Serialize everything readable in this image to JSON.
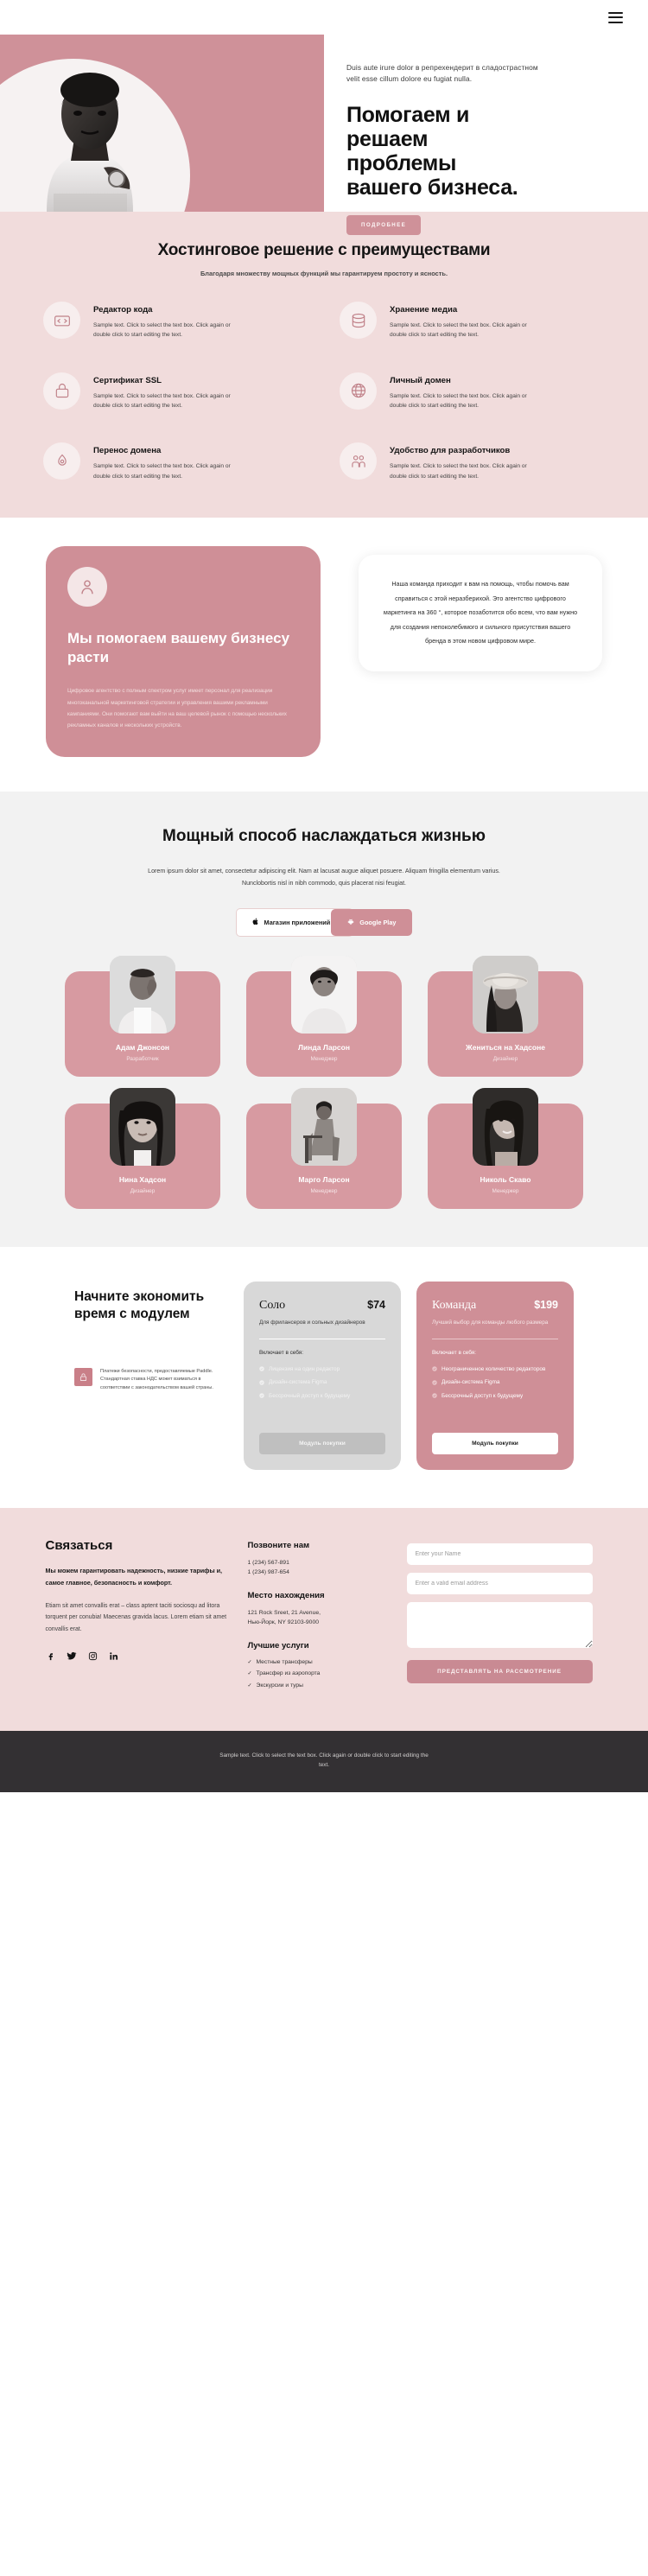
{
  "nav": {
    "menu_icon": "hamburger-menu-icon"
  },
  "hero": {
    "lead": "Duis aute irure dolor в репрехендерит в сладострастном velit esse cillum dolore eu fugiat nulla.",
    "title": "Помогаем и решаем проблемы вашего бизнеса.",
    "cta": "ПОДРОБНЕЕ"
  },
  "features": {
    "title": "Хостинговое решение с преимуществами",
    "subtitle": "Благодаря множеству мощных функций мы гарантируем простоту и ясность.",
    "body": "Sample text. Click to select the text box. Click again or double click to start editing the text.",
    "items": [
      {
        "icon": "code-editor-icon",
        "title": "Редактор кода"
      },
      {
        "icon": "database-storage-icon",
        "title": "Хранение медиа"
      },
      {
        "icon": "ssl-lock-icon",
        "title": "Сертификат SSL"
      },
      {
        "icon": "globe-www-icon",
        "title": "Личный домен"
      },
      {
        "icon": "domain-transfer-icon",
        "title": "Перенос домена"
      },
      {
        "icon": "developers-group-icon",
        "title": "Удобство для разработчиков"
      }
    ]
  },
  "help": {
    "avatar_icon": "person-avatar-icon",
    "title": "Мы помогаем вашему бизнесу расти",
    "body": "Цифровое агентство с полным спектром услуг имеет персонал для реализации многоканальной маркетинговой стратегии и управления вашими рекламными кампаниями. Они помогают вам выйти на ваш целевой рынок с помощью нескольких рекламных каналов и нескольких устройств.",
    "quote": "Наша команда приходит к вам на помощь, чтобы помочь вам справиться с этой неразберихой. Это агентство цифрового маркетинга на 360 °, которое позаботится обо всем, что вам нужно для создания непоколебимого и сильного присутствия вашего бренда в этом новом цифровом мире."
  },
  "power": {
    "title": "Мощный способ наслаждаться жизнью",
    "body": "Lorem ipsum dolor sit amet, consectetur adipiscing elit. Nam at lacusat augue aliquet posuere. Aliquam fringilla elementum varius. Nunclobortis nisl in nibh commodo, quis placerat nisi feugiat.",
    "appstore_label": "Магазин приложений",
    "appstore_icon": "apple-icon",
    "googleplay_label": "Google Play",
    "googleplay_icon": "android-icon"
  },
  "team": {
    "members": [
      {
        "name": "Адам Джонсон",
        "role": "Разработчик",
        "photo": "portrait-man-hand-on-face"
      },
      {
        "name": "Линда Ларсон",
        "role": "Менеджер",
        "photo": "portrait-woman-smiling"
      },
      {
        "name": "Жениться на Хадсоне",
        "role": "Дизайнер",
        "photo": "portrait-woman-hat"
      },
      {
        "name": "Нина Хадсон",
        "role": "Дизайнер",
        "photo": "portrait-woman-dark-hair"
      },
      {
        "name": "Марго Ларсон",
        "role": "Менеджер",
        "photo": "portrait-woman-sitting-chair"
      },
      {
        "name": "Николь Скаво",
        "role": "Менеджер",
        "photo": "portrait-woman-long-hair"
      }
    ]
  },
  "pricing": {
    "title": "Начните экономить время с модулем",
    "secure_icon": "lock-icon",
    "secure_note": "Платежи безопасности, предоставляемые Paddle. Стандартная ставка НДС может взиматься в соответствии с законодательством вашей страны.",
    "plans": [
      {
        "name": "Соло",
        "price": "$74",
        "desc": "Для фрилансеров и сольных дизайнеров",
        "includes_label": "Включает в себя:",
        "features": [
          "Лицензия на один редактор",
          "Дизайн-система Figma",
          "Бессрочный доступ к будущему"
        ],
        "cta": "Модуль покупки"
      },
      {
        "name": "Команда",
        "price": "$199",
        "desc": "Лучший выбор для команды любого размера",
        "includes_label": "Включает в себя:",
        "features": [
          "Неограниченное количество редакторов",
          "Дизайн-система Figma",
          "Бессрочный доступ к будущему"
        ],
        "cta": "Модуль покупки"
      }
    ]
  },
  "contact": {
    "title": "Связаться",
    "strong": "Мы можем гарантировать надежность, низкие тарифы и, самое главное, безопасность и комфорт.",
    "text": "Etiam sit amet convallis erat – class aptent taciti sociosqu ad litora torquent per conubia! Maecenas gravida lacus. Lorem etiam sit amet convallis erat.",
    "socials": [
      {
        "icon": "facebook-icon"
      },
      {
        "icon": "twitter-icon"
      },
      {
        "icon": "instagram-icon"
      },
      {
        "icon": "linkedin-icon"
      }
    ],
    "phone_title": "Позвоните нам",
    "phone1": "1 (234) 567-891",
    "phone2": "1 (234) 987-654",
    "location_title": "Место нахождения",
    "address1": "121 Rock Sreet, 21 Avenue,",
    "address2": "Нью-Йорк, NY 92103-9000",
    "services_title": "Лучшие услуги",
    "services": [
      "Местные трансферы",
      "Трансфер из аэропорта",
      "Экскурсии и туры"
    ],
    "form": {
      "name_placeholder": "Enter your Name",
      "email_placeholder": "Enter a valid email address",
      "message_placeholder": "",
      "submit": "ПРЕДСТАВЛЯТЬ НА РАССМОТРЕНИЕ"
    }
  },
  "footer": {
    "text": "Sample text. Click to select the text box. Click again or double click to start editing the text."
  },
  "colors": {
    "brand_rose": "#cf8f97",
    "soft_pink": "#f1dcdc",
    "light_grey": "#f2f2f2",
    "dark": "#333033"
  }
}
